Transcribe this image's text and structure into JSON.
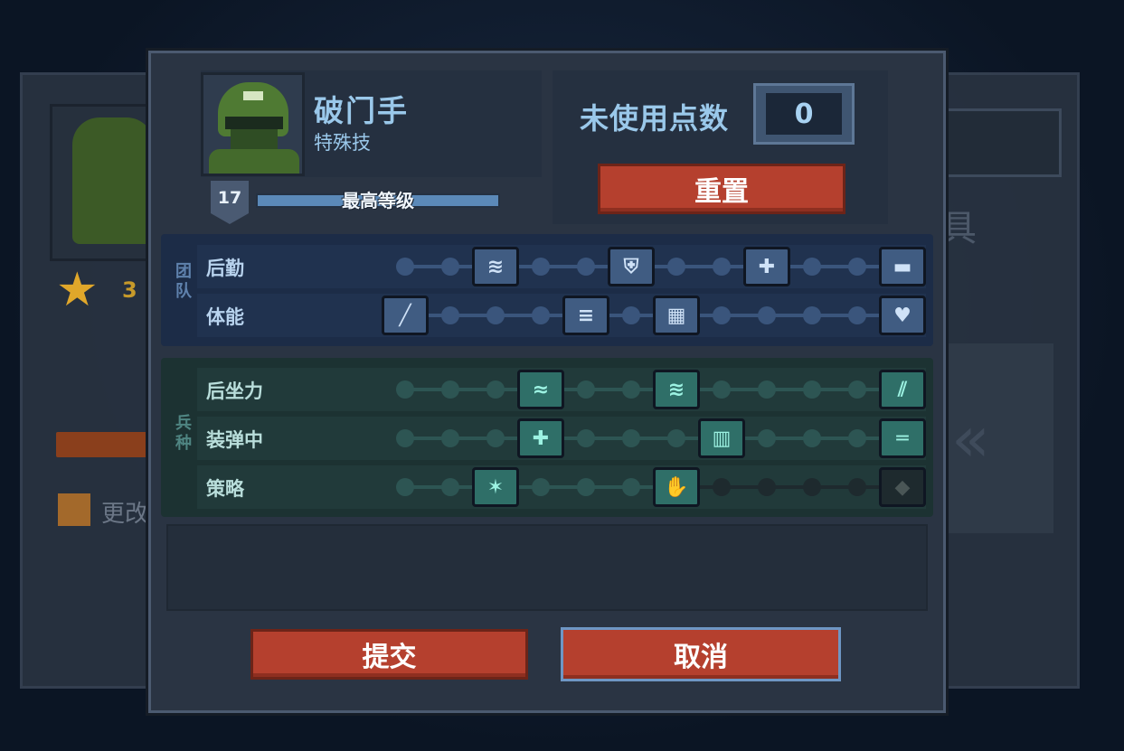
{
  "colors": {
    "team_track": "#3a557c",
    "team_node": "#5e7fa8",
    "class_track": "#2d5553",
    "class_node": "#5ec4b2",
    "locked": "#1e2a2e",
    "button": "#b5402e"
  },
  "background": {
    "stars": "3",
    "change_label": "更改",
    "right_char": "具"
  },
  "hero": {
    "class_name": "破门手",
    "subtitle": "特殊技",
    "level": "17",
    "level_bar_text": "最高等级",
    "portrait": "soldier-portrait"
  },
  "points": {
    "label": "未使用点数",
    "value": "0"
  },
  "buttons": {
    "reset": "重置",
    "submit": "提交",
    "cancel": "取消"
  },
  "groups": {
    "team": {
      "label": "团队",
      "rows": [
        {
          "name": "后勤",
          "nodes": [
            3,
            6,
            9,
            12
          ],
          "icons": [
            "supply-icon",
            "shield-plus-icon",
            "medkit-icon",
            "crate-icon"
          ]
        },
        {
          "name": "体能",
          "nodes": [
            1,
            5,
            7,
            12
          ],
          "icons": [
            "knife-icon",
            "sprint-icon",
            "armor-icon",
            "heart-icon"
          ]
        }
      ]
    },
    "class": {
      "label": "兵种",
      "rows": [
        {
          "name": "后坐力",
          "nodes": [
            4,
            7,
            12
          ],
          "icons": [
            "grip-icon",
            "muzzle-icon",
            "claw-icon"
          ],
          "locked_after": null
        },
        {
          "name": "装弹中",
          "nodes": [
            4,
            8,
            12
          ],
          "icons": [
            "ammo-plus-icon",
            "magazine-icon",
            "rifle-icon"
          ],
          "locked_after": null
        },
        {
          "name": "策略",
          "nodes": [
            3,
            7,
            12
          ],
          "icons": [
            "breach-icon",
            "glove-icon",
            "shield-icon"
          ],
          "locked_after": 7
        }
      ]
    }
  }
}
